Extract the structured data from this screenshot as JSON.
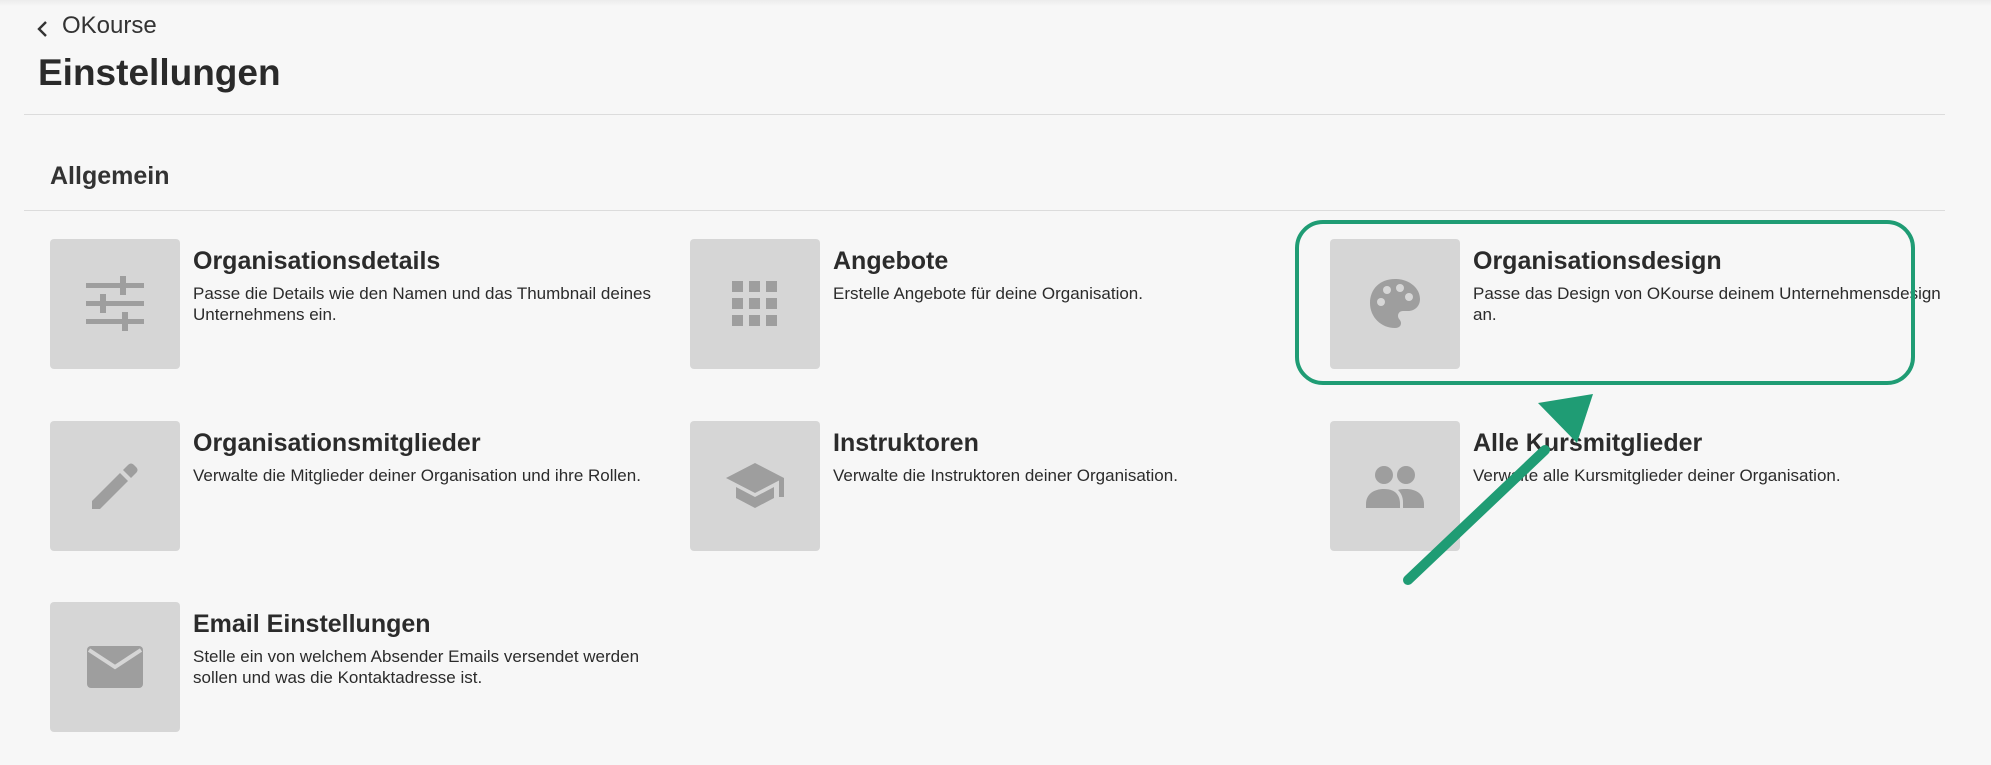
{
  "header": {
    "back_label": "OKourse",
    "title": "Einstellungen"
  },
  "section": {
    "title": "Allgemein"
  },
  "cards": [
    {
      "title": "Organisationsdetails",
      "description": "Passe die Details wie den Namen und das Thumbnail deines Unternehmens ein.",
      "icon": "sliders-icon"
    },
    {
      "title": "Angebote",
      "description": "Erstelle Angebote für deine Organisation.",
      "icon": "grid-icon"
    },
    {
      "title": "Organisationsdesign",
      "description": "Passe das Design von OKourse deinem Unternehmensdesign an.",
      "icon": "palette-icon"
    },
    {
      "title": "Organisationsmitglieder",
      "description": "Verwalte die Mitglieder deiner Organisation und ihre Rollen.",
      "icon": "pencil-icon"
    },
    {
      "title": "Instruktoren",
      "description": "Verwalte die Instruktoren deiner Organisation.",
      "icon": "graduation-cap-icon"
    },
    {
      "title": "Alle Kursmitglieder",
      "description": "Verwalte alle Kursmitglieder deiner Organisation.",
      "icon": "people-icon"
    },
    {
      "title": "Email Einstellungen",
      "description": "Stelle ein von welchem Absender Emails versendet werden sollen und was die Kontaktadresse ist.",
      "icon": "envelope-icon"
    }
  ],
  "colors": {
    "background": "#f7f7f7",
    "thumbnail": "#d6d6d6",
    "icon": "#9e9e9e",
    "annotation": "#1f9c74"
  }
}
